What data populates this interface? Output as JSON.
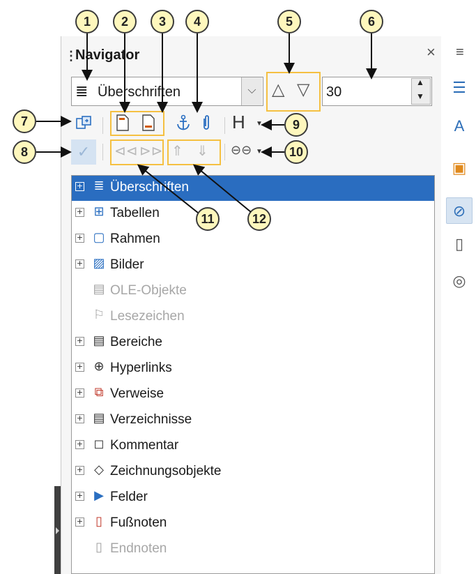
{
  "panel": {
    "title": "Navigator",
    "grip": "⋮",
    "close": "×",
    "menu": "≡"
  },
  "toolbar": {
    "category_select": {
      "value": "Überschriften",
      "icon": "headings-icon"
    },
    "dropdown_caret": "⌵",
    "level_up": "△",
    "level_down": "▽",
    "outline_level": "30",
    "row1": {
      "toggle_icon": "content-navigation-toggle-icon",
      "header_icon": "header-icon",
      "footer_icon": "footer-icon",
      "anchor_icon": "anchor-icon",
      "endnote_icon": "paperclip-icon",
      "heading_label": "H",
      "caret": "▼"
    },
    "row2": {
      "check_icon": "✓",
      "prev": "⊲⊲",
      "next": "⊳⊳",
      "promote": "⇑",
      "demote": "⇓",
      "link_icon": "⊖⊖",
      "caret": "▼"
    }
  },
  "tree": [
    {
      "label": "Überschriften",
      "icon": "≣",
      "expandable": true,
      "selected": true,
      "disabled": false
    },
    {
      "label": "Tabellen",
      "icon": "⊞",
      "expandable": true,
      "selected": false,
      "disabled": false
    },
    {
      "label": "Rahmen",
      "icon": "▢",
      "expandable": true,
      "selected": false,
      "disabled": false
    },
    {
      "label": "Bilder",
      "icon": "▨",
      "expandable": true,
      "selected": false,
      "disabled": false
    },
    {
      "label": "OLE-Objekte",
      "icon": "▤",
      "expandable": false,
      "selected": false,
      "disabled": true
    },
    {
      "label": "Lesezeichen",
      "icon": "⚐",
      "expandable": false,
      "selected": false,
      "disabled": true
    },
    {
      "label": "Bereiche",
      "icon": "▤",
      "expandable": true,
      "selected": false,
      "disabled": false
    },
    {
      "label": "Hyperlinks",
      "icon": "⊕",
      "expandable": true,
      "selected": false,
      "disabled": false
    },
    {
      "label": "Verweise",
      "icon": "⧉",
      "expandable": true,
      "selected": false,
      "disabled": false
    },
    {
      "label": "Verzeichnisse",
      "icon": "▤",
      "expandable": true,
      "selected": false,
      "disabled": false
    },
    {
      "label": "Kommentar",
      "icon": "◻",
      "expandable": true,
      "selected": false,
      "disabled": false
    },
    {
      "label": "Zeichnungsobjekte",
      "icon": "◇",
      "expandable": true,
      "selected": false,
      "disabled": false
    },
    {
      "label": "Felder",
      "icon": "▶",
      "expandable": true,
      "selected": false,
      "disabled": false
    },
    {
      "label": "Fußnoten",
      "icon": "▯",
      "expandable": true,
      "selected": false,
      "disabled": false
    },
    {
      "label": "Endnoten",
      "icon": "▯",
      "expandable": false,
      "selected": false,
      "disabled": true
    }
  ],
  "sidebar": [
    {
      "name": "properties-icon",
      "glyph": "☰"
    },
    {
      "name": "styles-icon",
      "glyph": "A"
    },
    {
      "name": "gallery-icon",
      "glyph": "▣"
    },
    {
      "name": "navigator-icon",
      "glyph": "⊘"
    },
    {
      "name": "page-icon",
      "glyph": "▯"
    },
    {
      "name": "style-inspector-icon",
      "glyph": "◎"
    }
  ],
  "callouts": [
    "1",
    "2",
    "3",
    "4",
    "5",
    "6",
    "7",
    "8",
    "9",
    "10",
    "11",
    "12"
  ],
  "colors": {
    "selection": "#2a6dc0",
    "highlight_border": "#f5c041",
    "callout_fill": "#fef7bd"
  }
}
